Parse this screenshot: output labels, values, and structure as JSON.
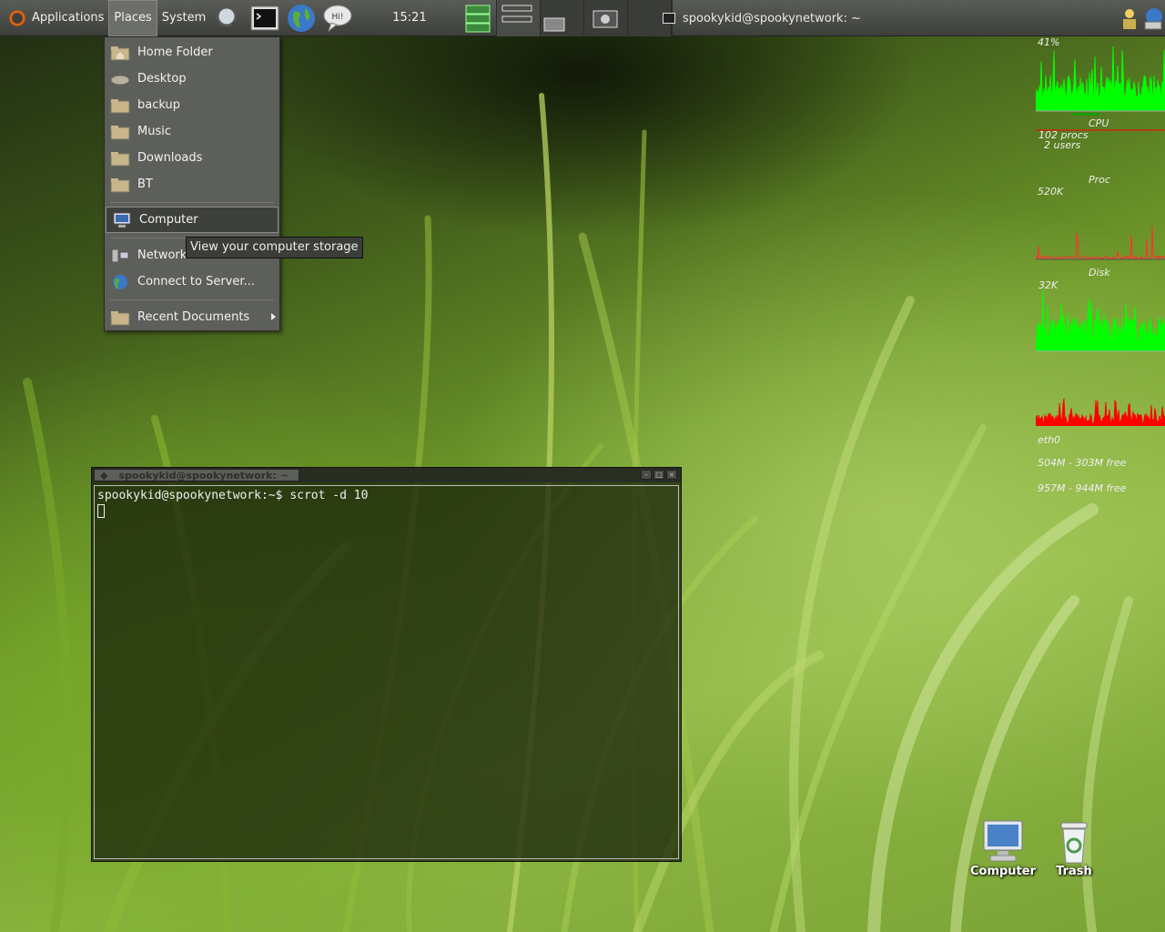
{
  "panel": {
    "menus": [
      "Applications",
      "Places",
      "System"
    ],
    "clock": "15:21",
    "launchers": [
      "search-tool",
      "terminal",
      "web-browser",
      "chat-messenger"
    ],
    "window_task": "spookykid@spookynetwork: ~"
  },
  "places_menu": {
    "items": [
      {
        "label": "Home Folder",
        "icon": "home-folder-icon"
      },
      {
        "label": "Desktop",
        "icon": "desktop-folder-icon"
      },
      {
        "label": "backup",
        "icon": "folder-icon"
      },
      {
        "label": "Music",
        "icon": "folder-icon"
      },
      {
        "label": "Downloads",
        "icon": "folder-icon"
      },
      {
        "label": "BT",
        "icon": "folder-icon"
      }
    ],
    "computer": "Computer",
    "network": "Network Servers",
    "network_visible": "Network",
    "connect": "Connect to Server...",
    "recent": "Recent Documents",
    "tooltip": "View your computer storage"
  },
  "conky": {
    "cpu_percent": "41%",
    "cpu_label": "CPU",
    "procs": "102 procs",
    "users": "2 users",
    "proc_label": "Proc",
    "disk_scale": "520K",
    "disk_label": "Disk",
    "net_scale": "32K",
    "net_label": "eth0",
    "mem1": "504M - 303M free",
    "mem2": "957M - 944M free"
  },
  "terminal": {
    "title": "spookykid@spookynetwork: ~",
    "line1": "spookykid@spookynetwork:~$ scrot -d 10"
  },
  "desktop_icons": {
    "computer": "Computer",
    "trash": "Trash"
  },
  "colors": {
    "panel": "#4a4c48",
    "menu": "#5d5f5a",
    "conky_green": "#00ff00",
    "conky_red": "#ff0000"
  }
}
